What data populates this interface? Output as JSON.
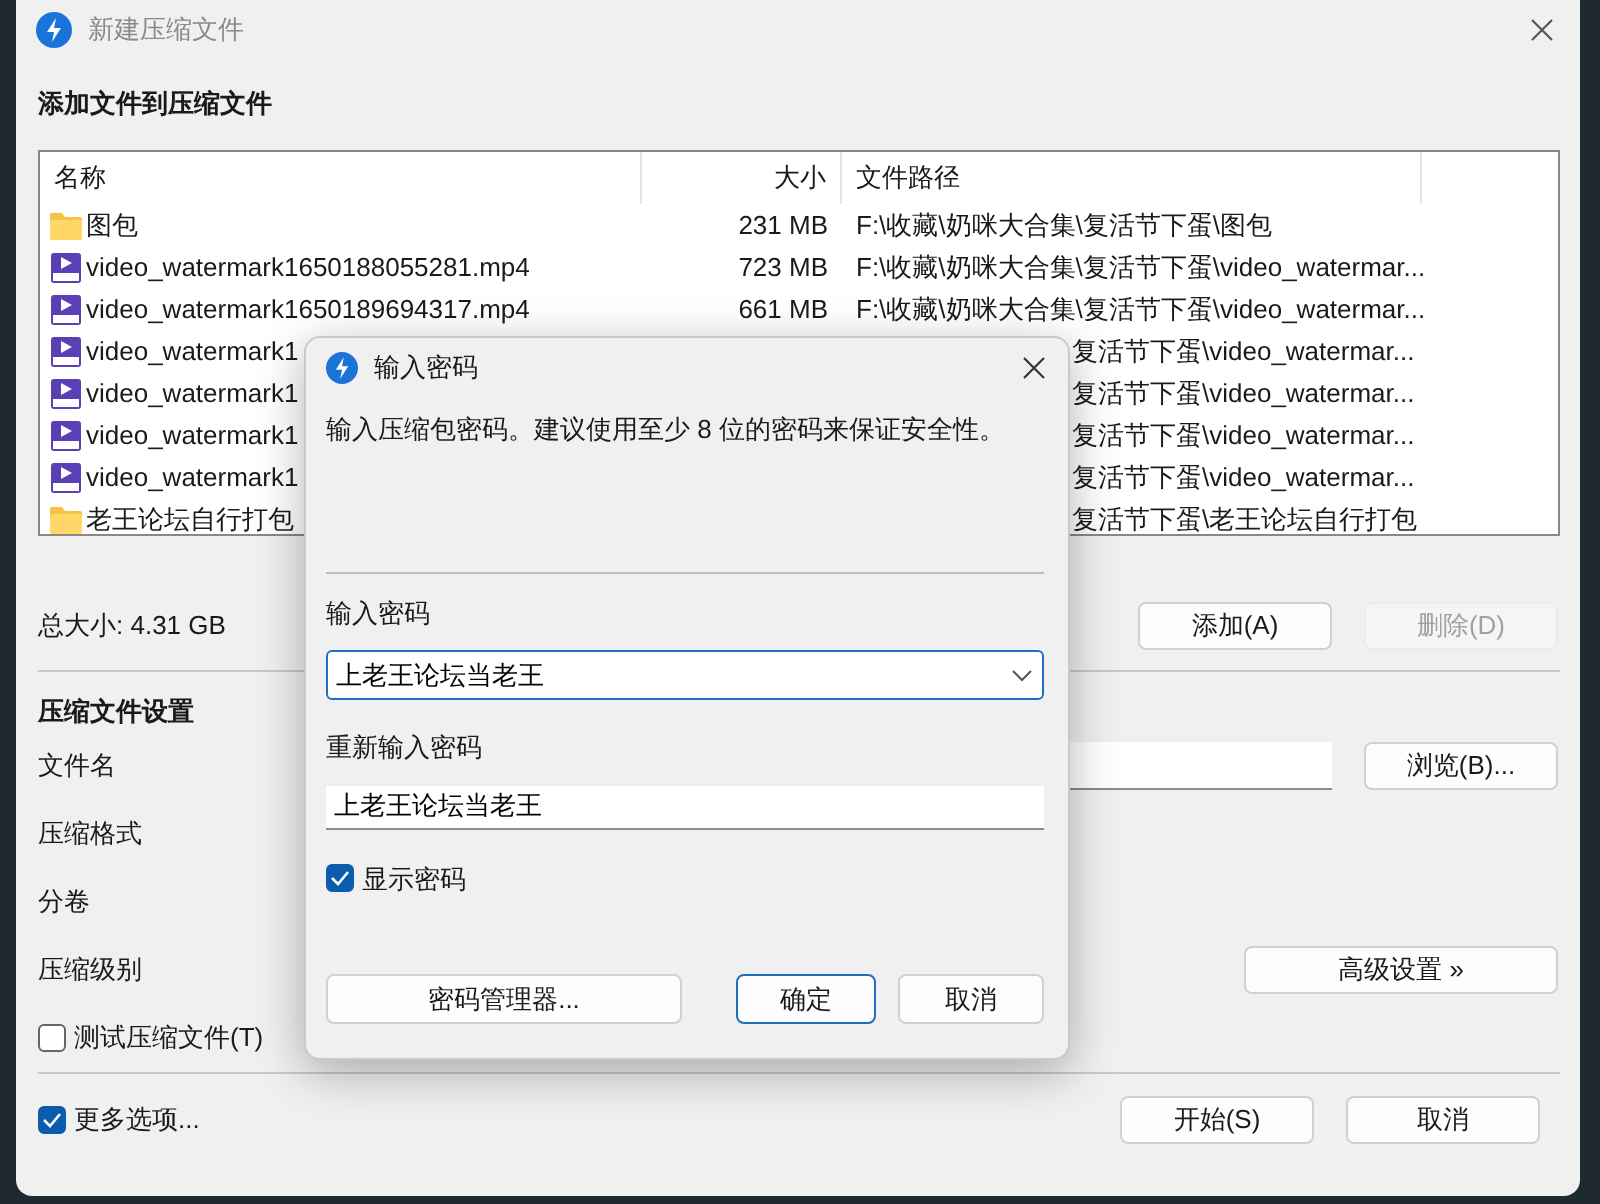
{
  "window": {
    "title": "新建压缩文件",
    "active": false
  },
  "heading": "添加文件到压缩文件",
  "file_list": {
    "columns": [
      "名称",
      "大小",
      "文件路径"
    ],
    "rows": [
      {
        "kind": "folder",
        "name": "图包",
        "size": "231 MB",
        "path": "F:\\收藏\\奶咪大合集\\复活节下蛋\\图包"
      },
      {
        "kind": "video",
        "name": "video_watermark1650188055281.mp4",
        "size": "723 MB",
        "path": "F:\\收藏\\奶咪大合集\\复活节下蛋\\video_watermar..."
      },
      {
        "kind": "video",
        "name": "video_watermark1650189694317.mp4",
        "size": "661 MB",
        "path": "F:\\收藏\\奶咪大合集\\复活节下蛋\\video_watermar..."
      },
      {
        "kind": "video",
        "name": "video_watermark1",
        "path": "复活节下蛋\\video_watermar..."
      },
      {
        "kind": "video",
        "name": "video_watermark1",
        "path": "复活节下蛋\\video_watermar..."
      },
      {
        "kind": "video",
        "name": "video_watermark1",
        "path": "复活节下蛋\\video_watermar..."
      },
      {
        "kind": "video",
        "name": "video_watermark1",
        "path": "复活节下蛋\\video_watermar..."
      },
      {
        "kind": "folder",
        "name": "老王论坛自行打包",
        "path": "复活节下蛋\\老王论坛自行打包"
      }
    ]
  },
  "total_size": "总大小: 4.31 GB",
  "list_buttons": [
    {
      "label": "添加(A)",
      "disabled": false
    },
    {
      "label": "删除(D)",
      "disabled": true
    }
  ],
  "settings": {
    "heading": "压缩文件设置",
    "labels": [
      "文件名",
      "压缩格式",
      "分卷",
      "压缩级别"
    ],
    "browse_button": "浏览(B)...",
    "advanced_button": "高级设置 »",
    "test_checkbox": {
      "label": "测试压缩文件(T)",
      "checked": false
    }
  },
  "more_options": {
    "label": "更多选项...",
    "checked": true
  },
  "footer_buttons": [
    "开始(S)",
    "取消"
  ],
  "password_dialog": {
    "title": "输入密码",
    "description": "输入压缩包密码。建议使用至少 8 位的密码来保证安全性。",
    "password_label": "输入密码",
    "password_value": "上老王论坛当老王",
    "repeat_label": "重新输入密码",
    "repeat_value": "上老王论坛当老王",
    "show_password": {
      "label": "显示密码",
      "checked": true
    },
    "manager_button": "密码管理器...",
    "ok_button": "确定",
    "cancel_button": "取消"
  }
}
